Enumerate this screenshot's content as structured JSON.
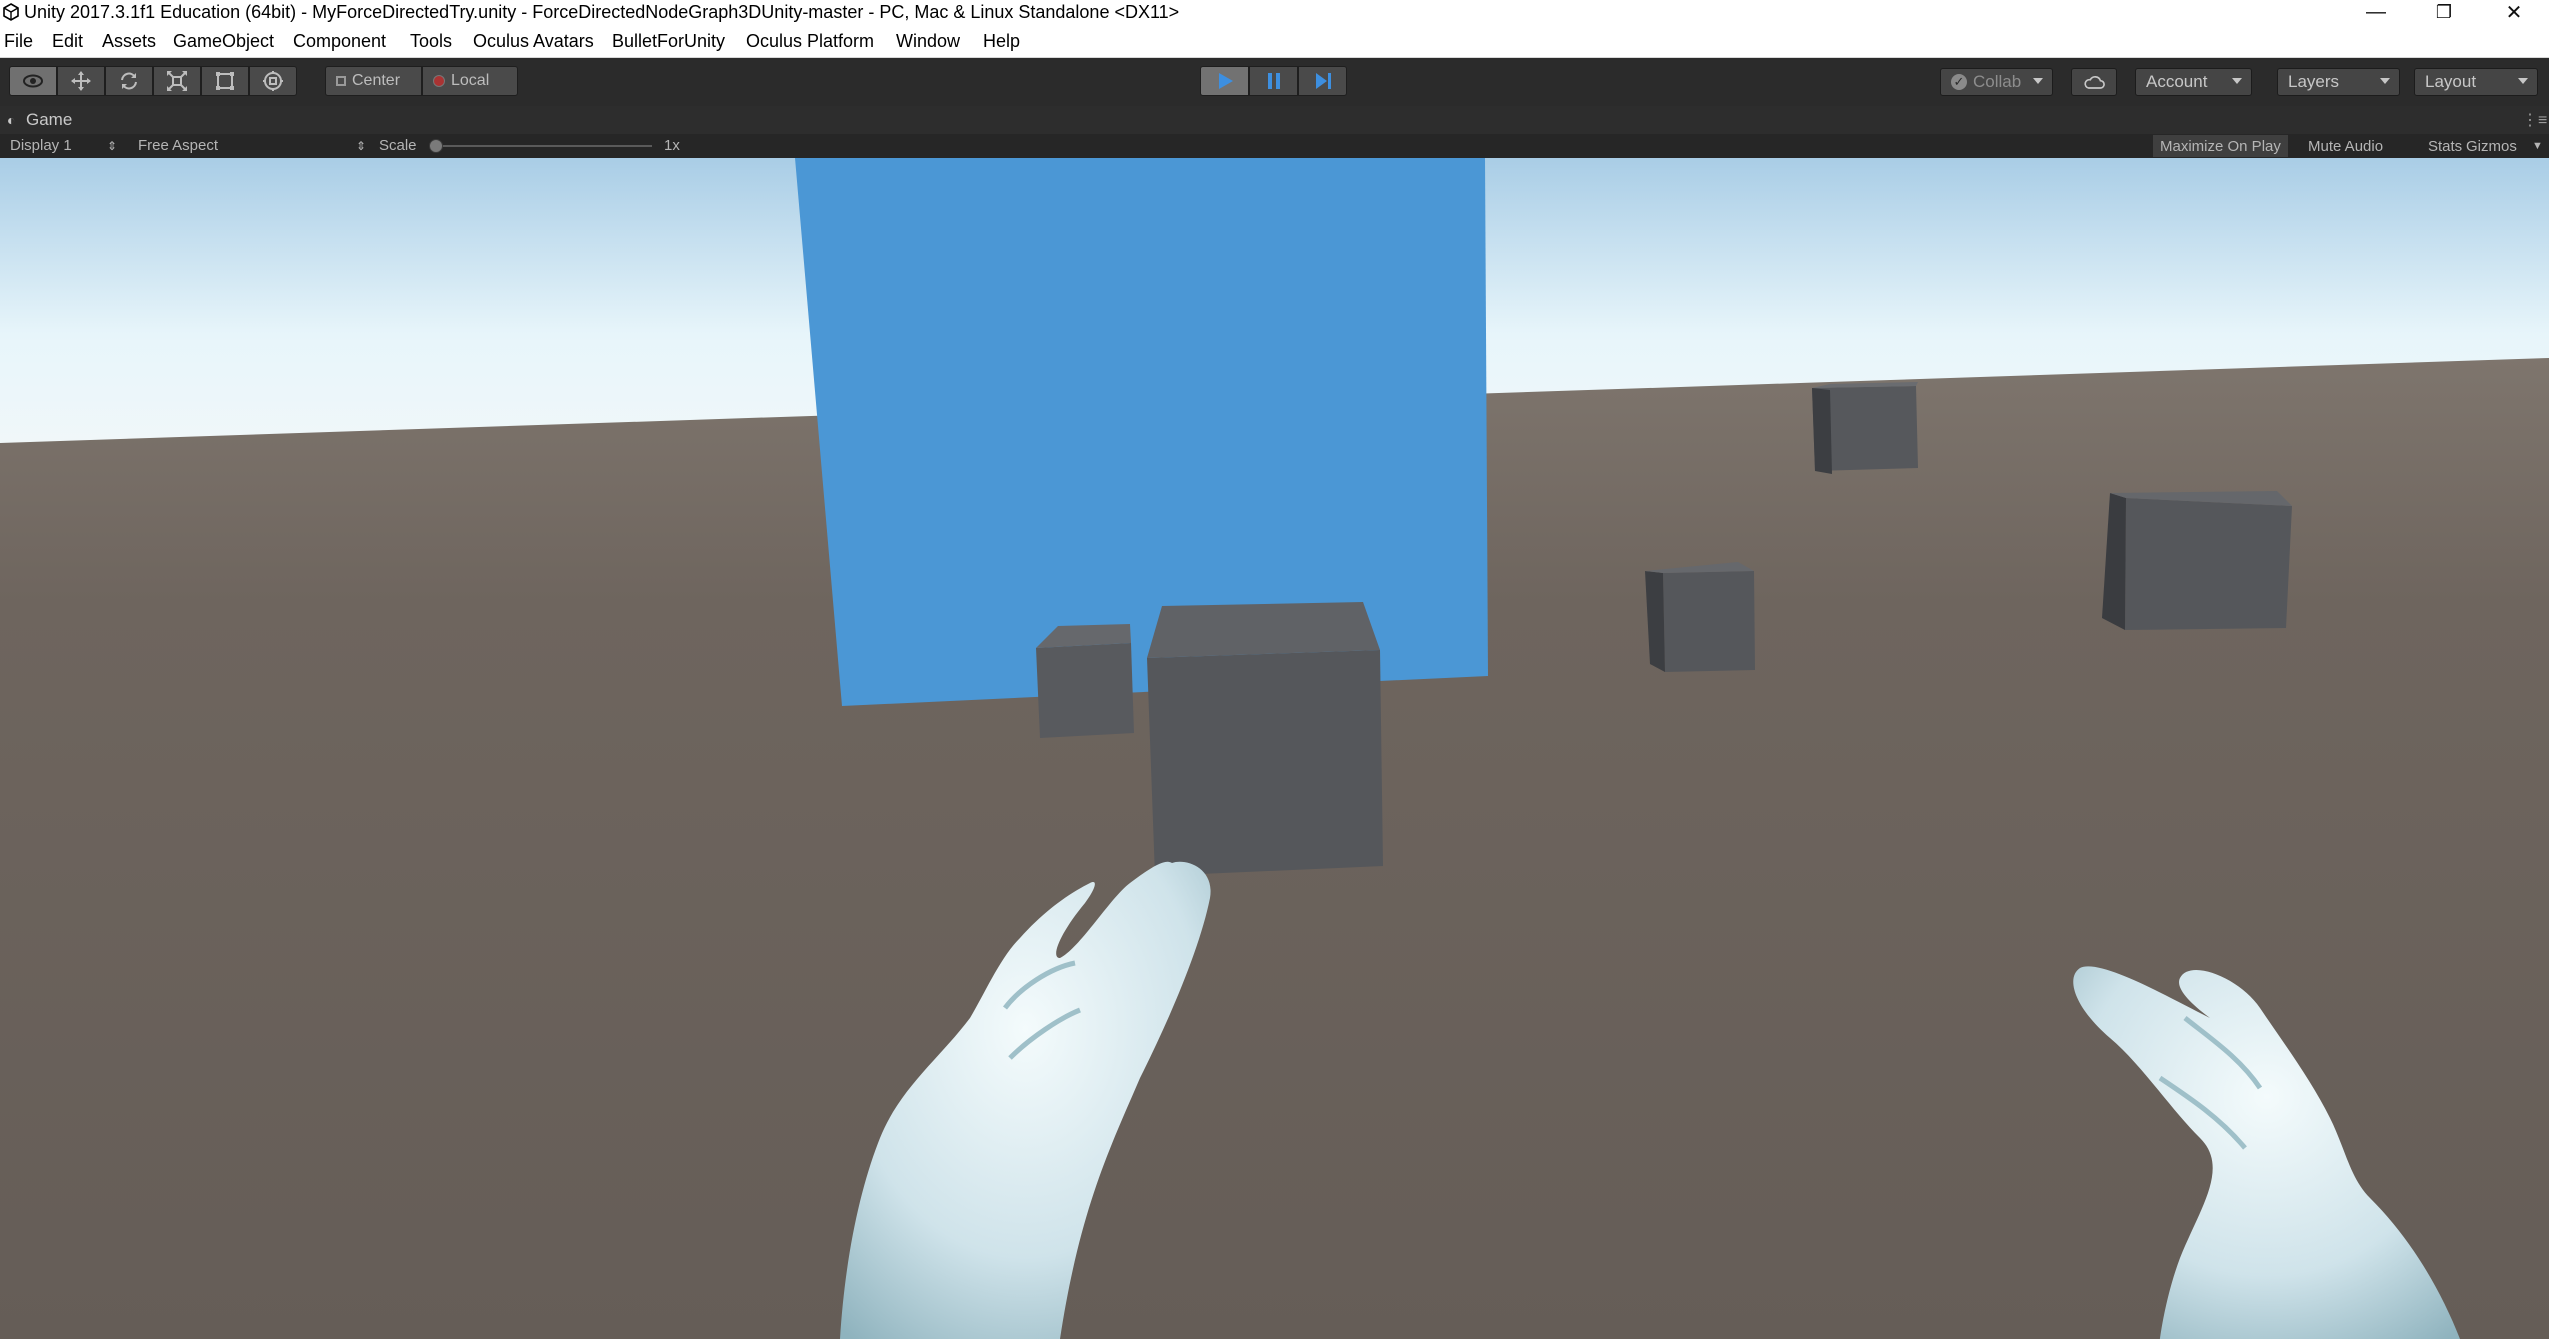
{
  "window": {
    "title": "Unity 2017.3.1f1 Education (64bit) - MyForceDirectedTry.unity - ForceDirectedNodeGraph3DUnity-master - PC, Mac & Linux Standalone <DX11>",
    "minimize_glyph": "—",
    "restore_glyph": "❐",
    "close_glyph": "✕"
  },
  "menu": [
    "File",
    "Edit",
    "Assets",
    "GameObject",
    "Component",
    "Tools",
    "Oculus Avatars",
    "BulletForUnity",
    "Oculus Platform",
    "Window",
    "Help"
  ],
  "toolbar": {
    "transform_tools": [
      "view-tool-icon",
      "move-tool-icon",
      "rotate-tool-icon",
      "scale-tool-icon",
      "rect-tool-icon",
      "transform-tool-icon"
    ],
    "pivot_label": "Center",
    "space_label": "Local",
    "collab_label": "Collab",
    "account_label": "Account",
    "layers_label": "Layers",
    "layout_label": "Layout",
    "play_state": "playing",
    "accent_color": "#3d8fe0"
  },
  "game_view": {
    "tab_label": "Game",
    "display_label": "Display 1",
    "aspect_label": "Free Aspect",
    "scale_label": "Scale",
    "scale_value": "1x",
    "maximize_label": "Maximize On Play",
    "mute_label": "Mute Audio",
    "stats_label": "Stats",
    "gizmos_label": "Gizmos"
  },
  "scene": {
    "sky_color": "#d9eef8",
    "ground_color": "#6b625b",
    "panel_color": "#4a97d6",
    "cube_color": "#55575b",
    "hand_color": "#cfe3ea"
  }
}
